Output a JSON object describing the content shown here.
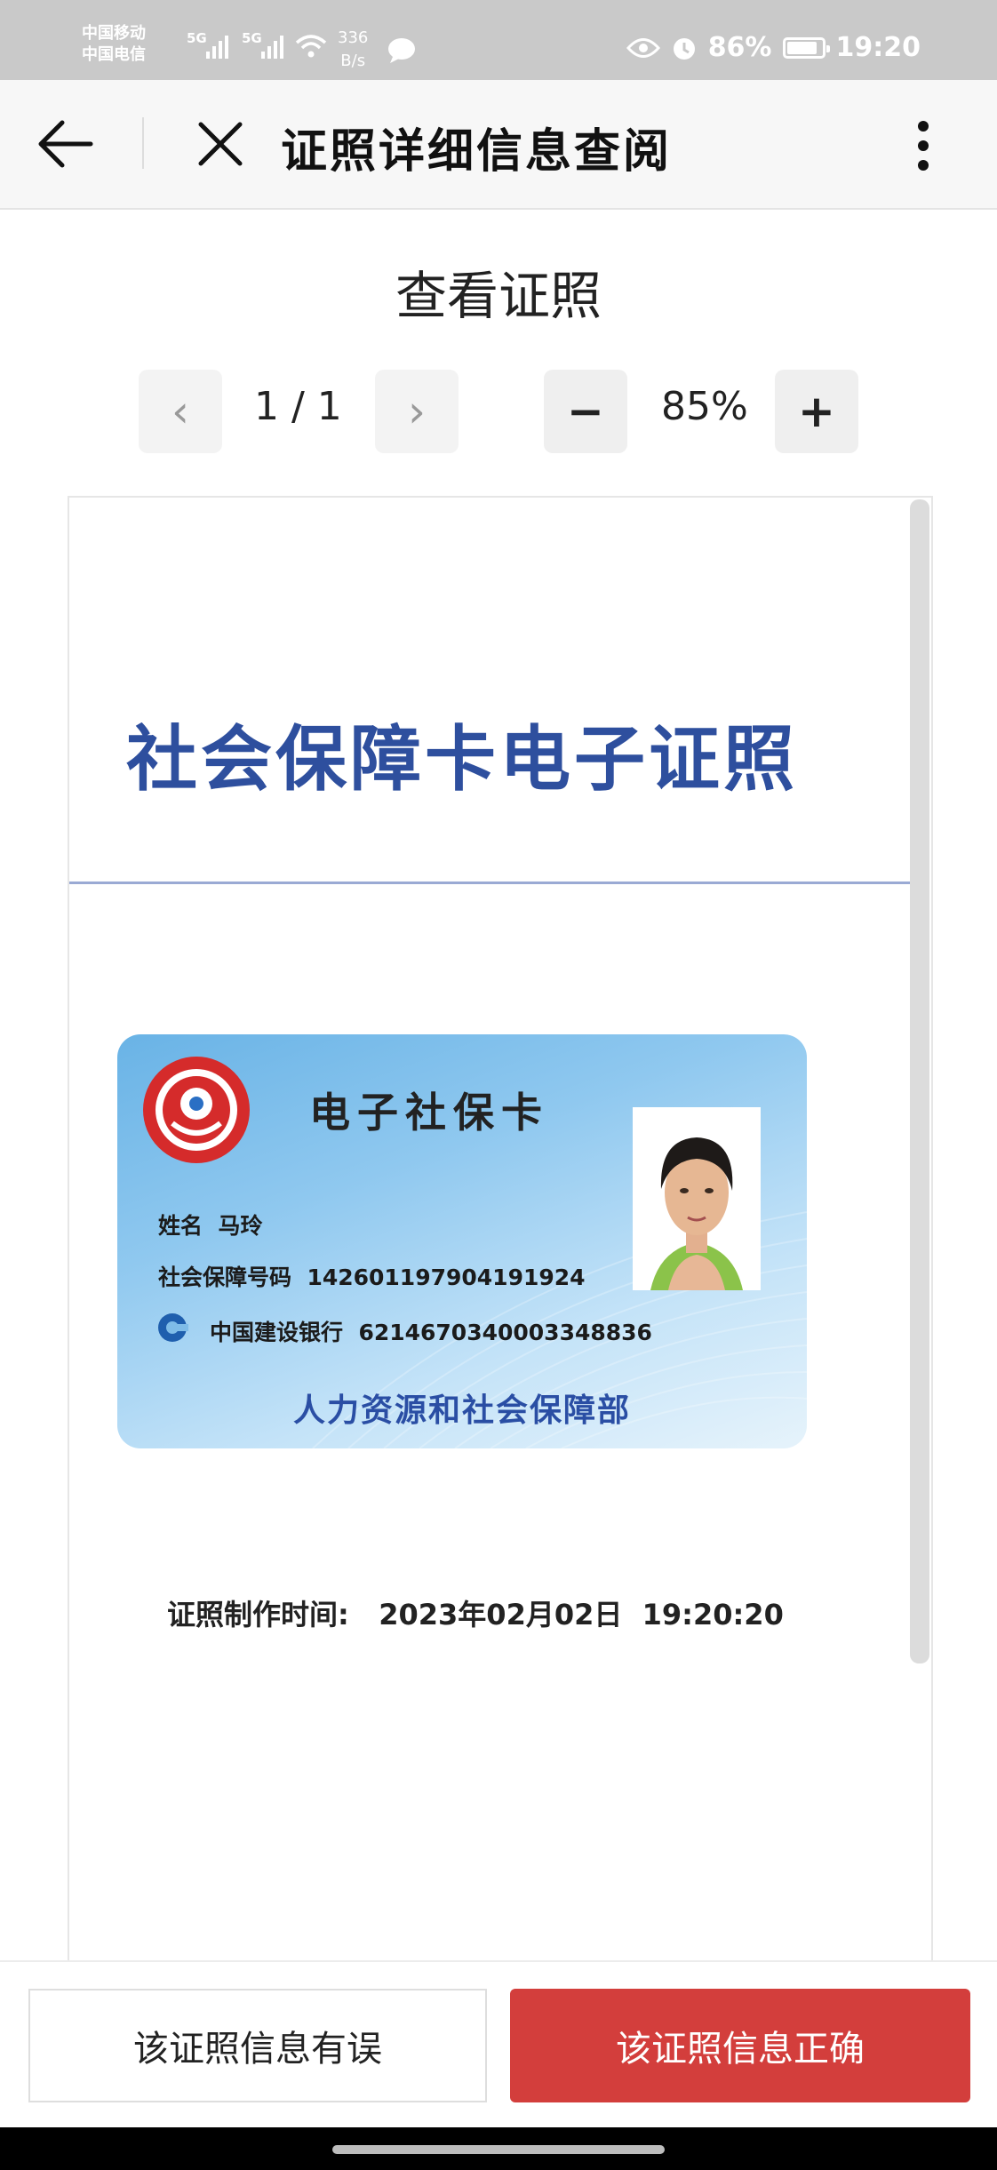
{
  "status_bar": {
    "carrier1": "中国移动",
    "carrier2": "中国电信",
    "net1": "5G",
    "net2": "5G",
    "speed_value": "336",
    "speed_unit": "B/s",
    "battery": "86%",
    "time": "19:20",
    "icons": [
      "hd-icon",
      "signal-icon",
      "wifi-icon",
      "chat-bubble-icon",
      "eye-icon",
      "alarm-icon",
      "battery-icon"
    ]
  },
  "header": {
    "title": "证照详细信息查阅"
  },
  "viewer": {
    "title": "查看证照",
    "page_indicator": "1 / 1",
    "zoom": "85%",
    "prev_symbol": "‹",
    "next_symbol": "›",
    "zoom_out_symbol": "−",
    "zoom_in_symbol": "+"
  },
  "document": {
    "heading": "社会保障卡电子证照",
    "card": {
      "title": "电子社保卡",
      "name_label": "姓名",
      "name_value": "马玲",
      "ssn_label": "社会保障号码",
      "ssn_value": "142601197904191924",
      "bank_name": "中国建设银行",
      "bank_number": "6214670340003348836",
      "issuer": "人力资源和社会保障部"
    },
    "made_time_label": "证照制作时间:",
    "made_time_value": "2023年02月02日  19:20:20"
  },
  "actions": {
    "wrong_label": "该证照信息有误",
    "correct_label": "该证照信息正确"
  },
  "colors": {
    "accent_red": "#d33e3c",
    "heading_blue": "#2e4f9e",
    "card_blue": "#69b3e6"
  }
}
